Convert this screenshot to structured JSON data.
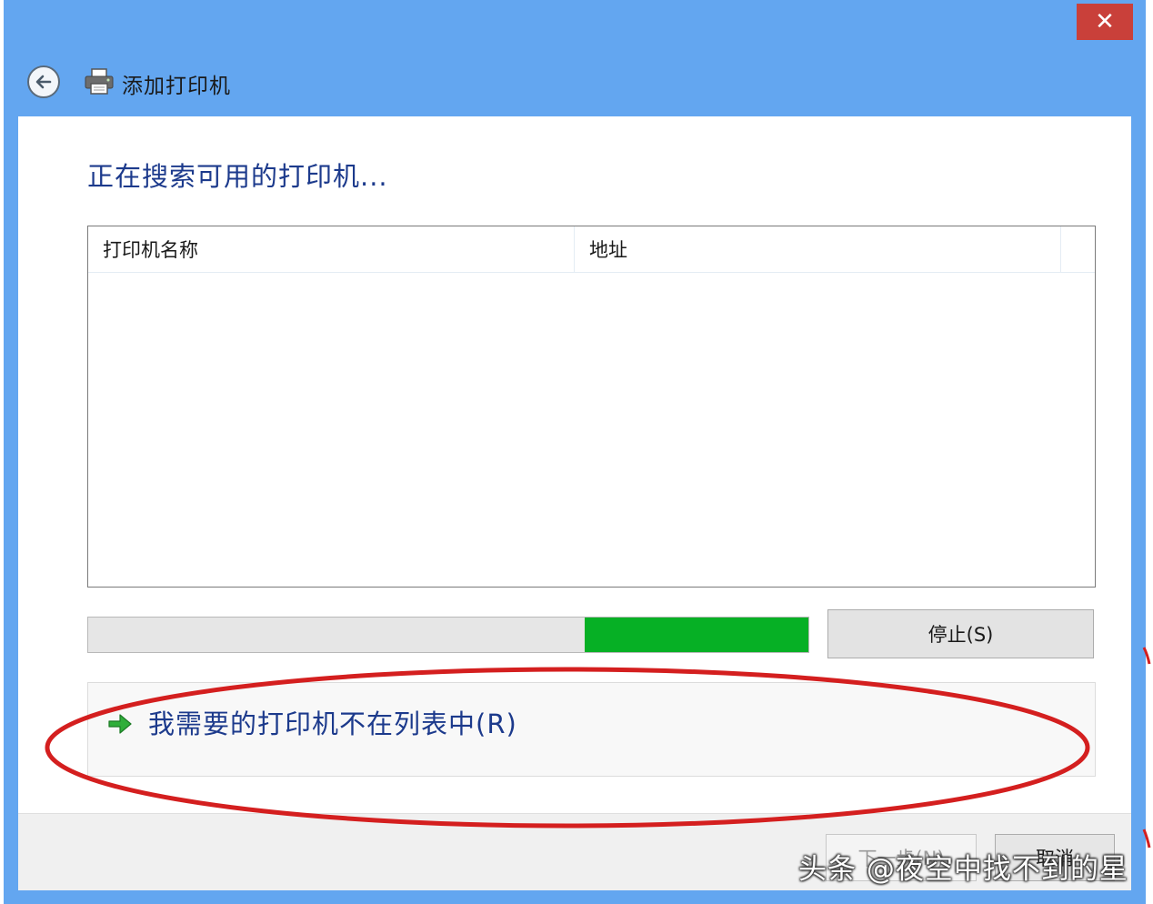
{
  "window": {
    "title": "添加打印机",
    "close_label": "✕"
  },
  "main": {
    "heading": "正在搜索可用的打印机...",
    "list": {
      "columns": [
        "打印机名称",
        "地址"
      ],
      "rows": []
    },
    "progress": {
      "segment_start": 0.69,
      "segment_end": 1.0,
      "fill_color": "#06b025"
    },
    "stop_label": "停止(S)",
    "not_listed_link": "我需要的打印机不在列表中(R)"
  },
  "footer": {
    "next_label": "下一步(N)",
    "cancel_label": "取消"
  },
  "annotation": {
    "color": "#d41f1f"
  },
  "watermark": "头条 @夜空中找不到的星",
  "colors": {
    "title_bar": "#63a6f0",
    "heading_text": "#1c3a8c",
    "close_button": "#c9403a"
  }
}
